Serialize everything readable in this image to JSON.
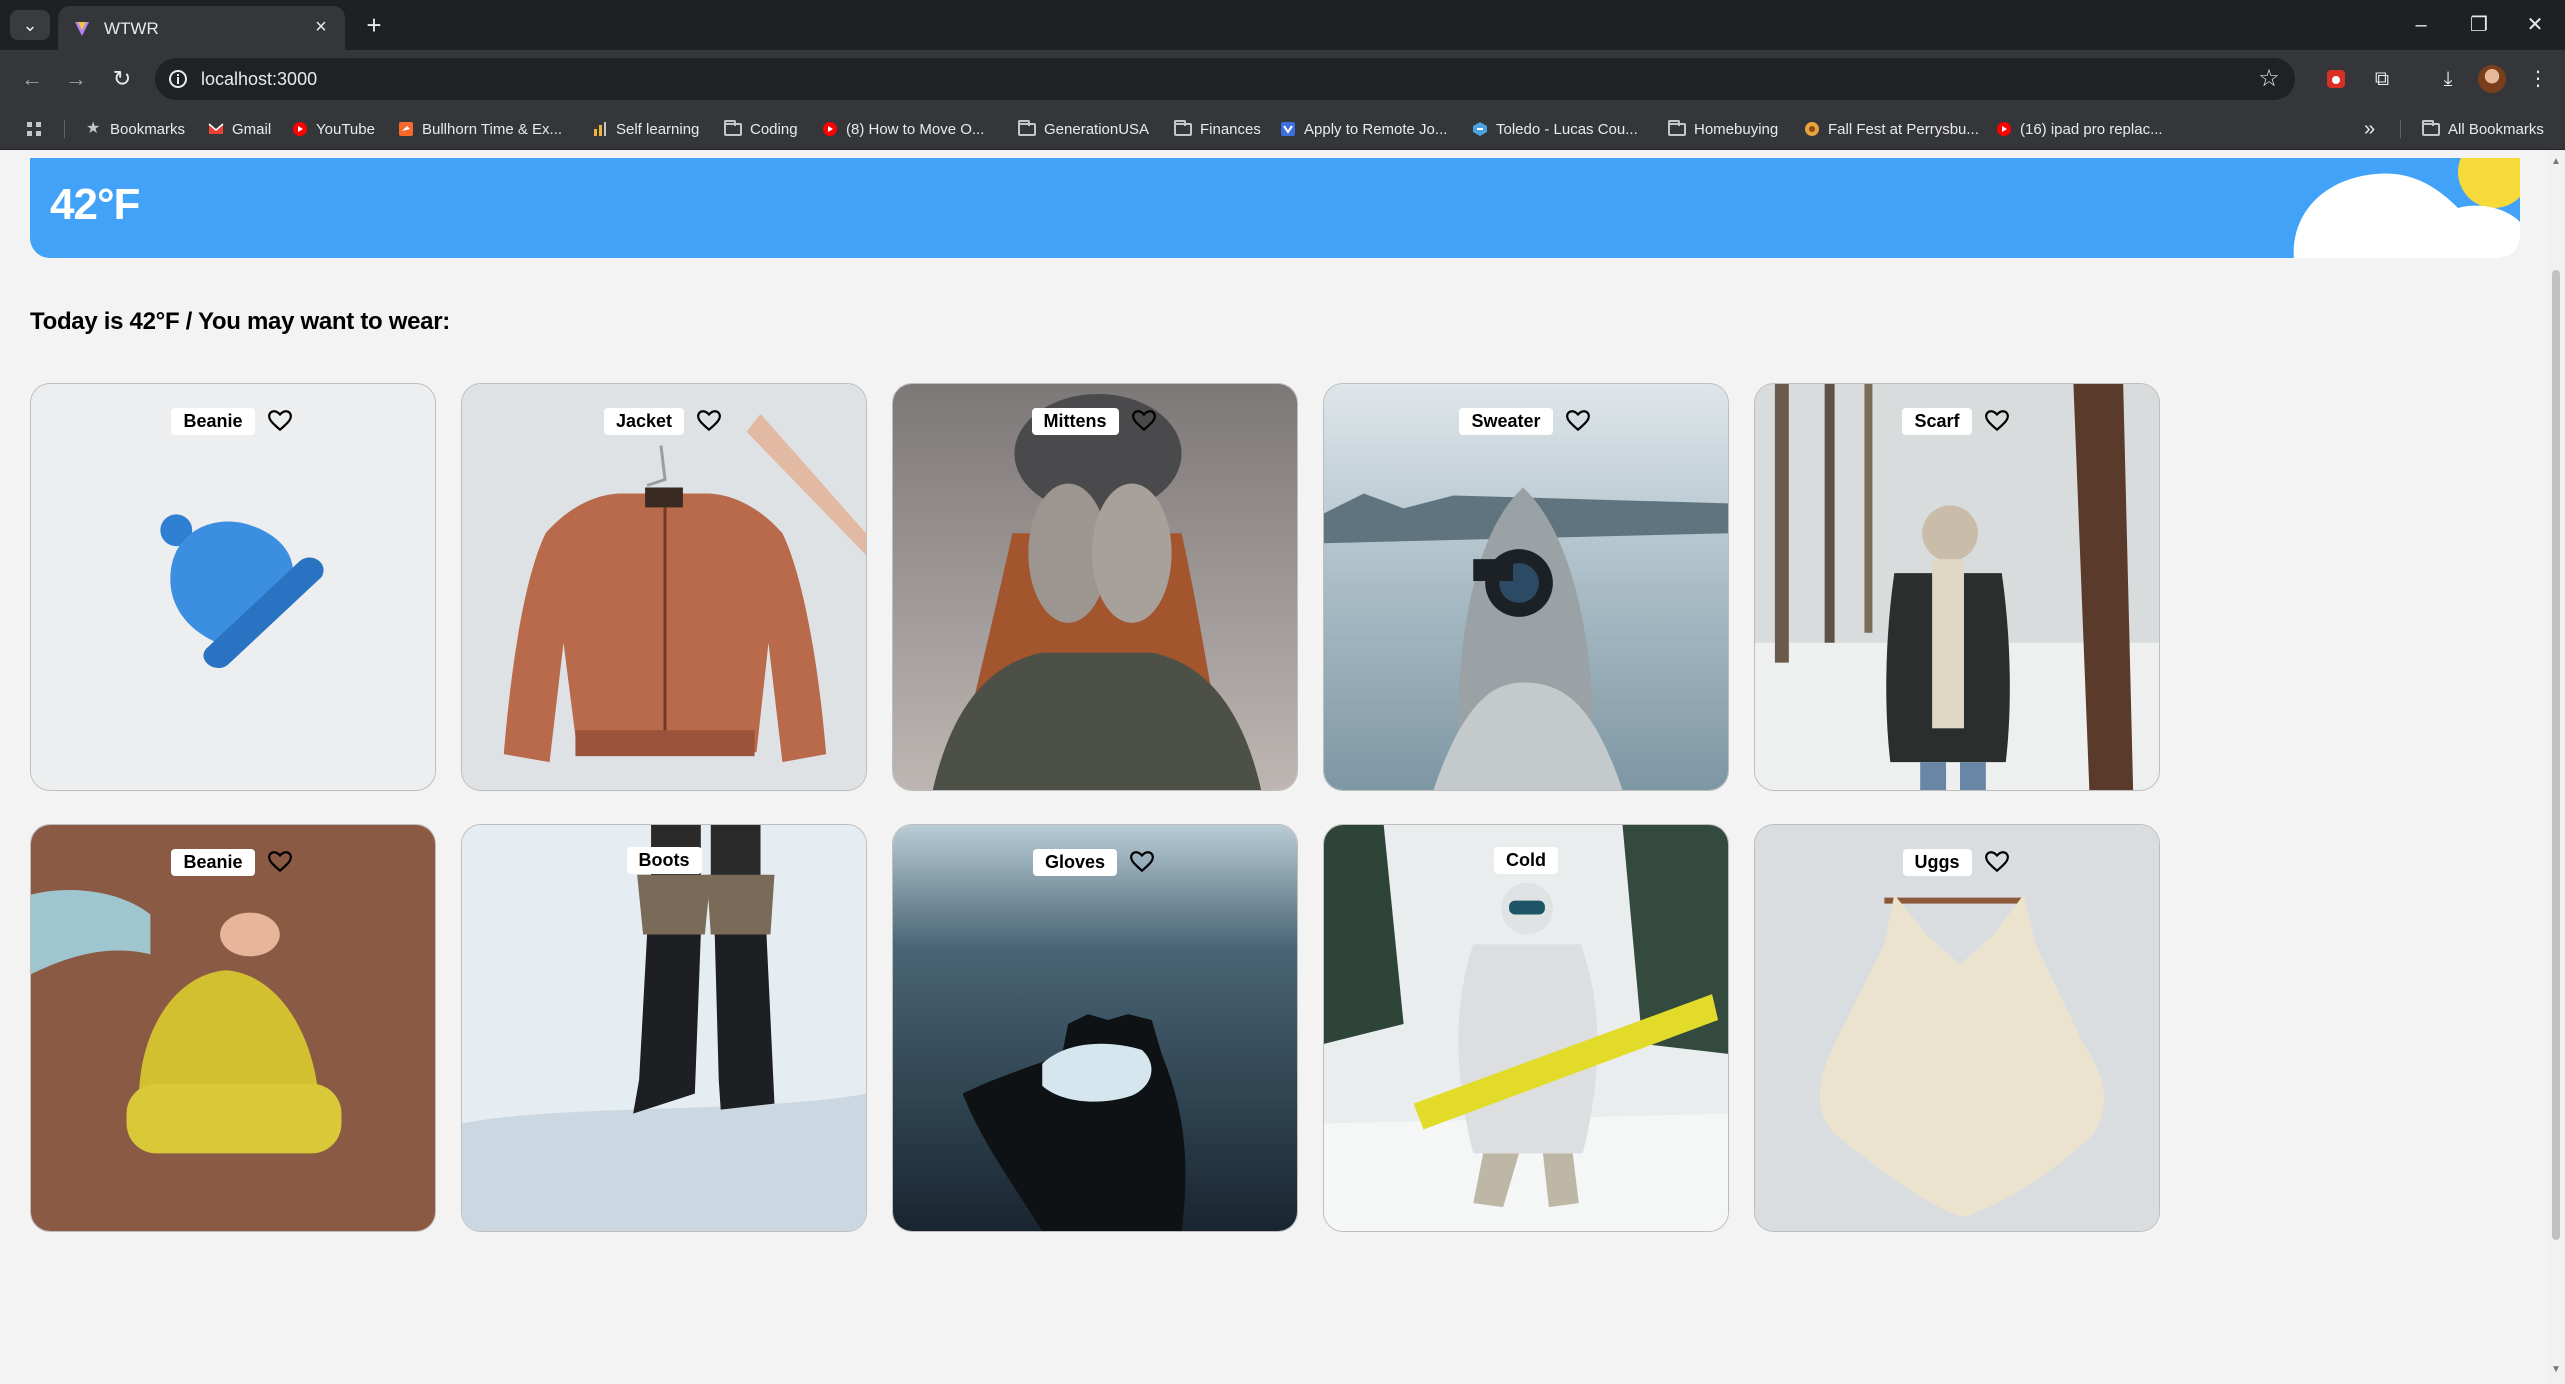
{
  "browser": {
    "tab_title": "WTWR",
    "url": "localhost:3000",
    "bookmarks": [
      {
        "label": "Bookmarks",
        "icon": "star-icon"
      },
      {
        "label": "Gmail",
        "icon": "gmail-icon"
      },
      {
        "label": "YouTube",
        "icon": "youtube-icon"
      },
      {
        "label": "Bullhorn Time & Ex...",
        "icon": "bullhorn-icon"
      },
      {
        "label": "Self learning",
        "icon": "bar-chart-icon"
      },
      {
        "label": "Coding",
        "icon": "folder-icon"
      },
      {
        "label": "(8) How to Move O...",
        "icon": "youtube-icon"
      },
      {
        "label": "GenerationUSA",
        "icon": "folder-icon"
      },
      {
        "label": "Finances",
        "icon": "folder-icon"
      },
      {
        "label": "Apply to Remote Jo...",
        "icon": "job-site-icon"
      },
      {
        "label": "Toledo - Lucas Cou...",
        "icon": "county-icon"
      },
      {
        "label": "Homebuying",
        "icon": "folder-icon"
      },
      {
        "label": "Fall Fest at Perrysbu...",
        "icon": "event-icon"
      },
      {
        "label": "(16) ipad pro replac...",
        "icon": "youtube-icon"
      }
    ],
    "all_bookmarks": "All Bookmarks",
    "more_bookmarks": "»"
  },
  "weather": {
    "temperature": "42°F"
  },
  "main": {
    "heading": "Today is 42°F / You may want to wear:"
  },
  "items": [
    {
      "name": "Beanie"
    },
    {
      "name": "Jacket"
    },
    {
      "name": "Mittens"
    },
    {
      "name": "Sweater"
    },
    {
      "name": "Scarf"
    },
    {
      "name": "Beanie"
    },
    {
      "name": "Boots"
    },
    {
      "name": "Gloves"
    },
    {
      "name": "Cold"
    },
    {
      "name": "Uggs"
    }
  ],
  "colors": {
    "weather_blue": "#41a2f7",
    "sun_yellow": "#f8d93a",
    "page_bg": "#f3f3f3"
  }
}
